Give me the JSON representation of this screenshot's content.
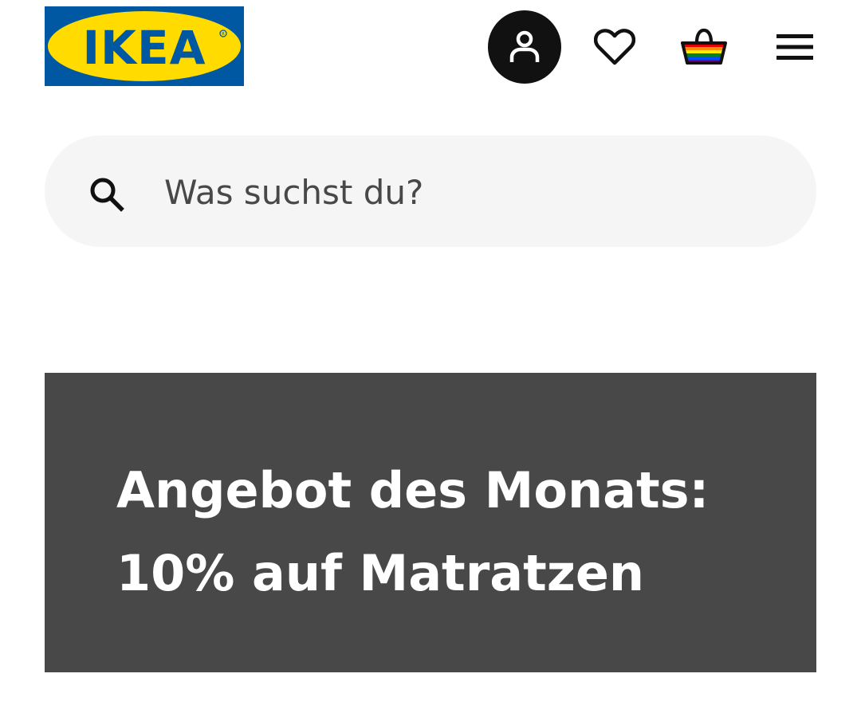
{
  "header": {
    "logo_text": "IKEA",
    "brand_colors": {
      "blue": "#0058a3",
      "yellow": "#ffdb00"
    },
    "icons": {
      "account": "person-icon",
      "favourites": "heart-icon",
      "cart": "shopping-basket-icon",
      "menu": "hamburger-menu-icon"
    }
  },
  "search": {
    "placeholder": "Was suchst du?",
    "icon": "search-icon"
  },
  "promo": {
    "title_line1": "Angebot des Monats:",
    "title_line2": "10% auf Matratzen",
    "background": "#484848"
  }
}
